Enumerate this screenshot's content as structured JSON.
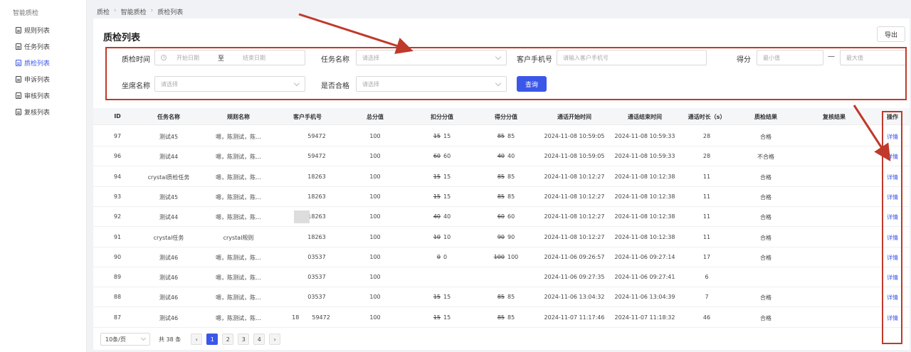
{
  "sidebar": {
    "group_title": "智能质检",
    "items": [
      {
        "label": "规则列表"
      },
      {
        "label": "任务列表"
      },
      {
        "label": "质检列表"
      },
      {
        "label": "申诉列表"
      },
      {
        "label": "审核列表"
      },
      {
        "label": "复核列表"
      }
    ],
    "active_index": 2
  },
  "breadcrumb": [
    "质检",
    "智能质检",
    "质检列表"
  ],
  "page": {
    "title": "质检列表",
    "export_label": "导出"
  },
  "filters": {
    "time_label": "质检时间",
    "start_placeholder": "开始日期",
    "to_label": "至",
    "end_placeholder": "结束日期",
    "task_label": "任务名称",
    "task_placeholder": "请选择",
    "phone_label": "客户手机号",
    "phone_placeholder": "请输入客户手机号",
    "score_label": "得分",
    "min_placeholder": "最小值",
    "dash": "—",
    "max_placeholder": "最大值",
    "agent_label": "坐席名称",
    "agent_placeholder": "请选择",
    "pass_label": "是否合格",
    "pass_placeholder": "请选择",
    "query_label": "查询"
  },
  "table": {
    "headers": [
      "ID",
      "任务名称",
      "规则名称",
      "客户手机号",
      "总分值",
      "扣分分值",
      "得分分值",
      "通话开始时间",
      "通话结束时间",
      "通话时长（s）",
      "质检结果",
      "复核结果",
      "操作"
    ],
    "rows": [
      {
        "id": "97",
        "task": "测试45",
        "rule": "嗯，陈测试，陈...",
        "phone": "59472",
        "total": "100",
        "deduct_old": "15",
        "deduct": "15",
        "score_old": "85",
        "score": "85",
        "start": "2024-11-08 10:59:05",
        "end": "2024-11-08 10:59:33",
        "dur": "28",
        "result": "合格",
        "review": "",
        "op": "详情"
      },
      {
        "id": "96",
        "task": "测试44",
        "rule": "嗯，陈测试，陈...",
        "phone": "59472",
        "total": "100",
        "deduct_old": "60",
        "deduct": "60",
        "score_old": "40",
        "score": "40",
        "start": "2024-11-08 10:59:05",
        "end": "2024-11-08 10:59:33",
        "dur": "28",
        "result": "不合格",
        "review": "",
        "op": "详情"
      },
      {
        "id": "94",
        "task": "crystal质检任务",
        "rule": "嗯，陈测试，陈...",
        "phone": "18263",
        "total": "100",
        "deduct_old": "15",
        "deduct": "15",
        "score_old": "85",
        "score": "85",
        "start": "2024-11-08 10:12:27",
        "end": "2024-11-08 10:12:38",
        "dur": "11",
        "result": "合格",
        "review": "",
        "op": "详情"
      },
      {
        "id": "93",
        "task": "测试45",
        "rule": "嗯，陈测试，陈...",
        "phone": "18263",
        "total": "100",
        "deduct_old": "15",
        "deduct": "15",
        "score_old": "85",
        "score": "85",
        "start": "2024-11-08 10:12:27",
        "end": "2024-11-08 10:12:38",
        "dur": "11",
        "result": "合格",
        "review": "",
        "op": "详情"
      },
      {
        "id": "92",
        "task": "测试44",
        "rule": "嗯，陈测试，陈...",
        "phone": "18263",
        "total": "100",
        "deduct_old": "40",
        "deduct": "40",
        "score_old": "60",
        "score": "60",
        "start": "2024-11-08 10:12:27",
        "end": "2024-11-08 10:12:38",
        "dur": "11",
        "result": "合格",
        "review": "",
        "op": "详情"
      },
      {
        "id": "91",
        "task": "crystal任务",
        "rule": "crystal规则",
        "phone": "18263",
        "total": "100",
        "deduct_old": "10",
        "deduct": "10",
        "score_old": "90",
        "score": "90",
        "start": "2024-11-08 10:12:27",
        "end": "2024-11-08 10:12:38",
        "dur": "11",
        "result": "合格",
        "review": "",
        "op": "详情"
      },
      {
        "id": "90",
        "task": "测试46",
        "rule": "嗯，陈测试，陈...",
        "phone": "03537",
        "total": "100",
        "deduct_old": "0",
        "deduct": "0",
        "score_old": "100",
        "score": "100",
        "start": "2024-11-06 09:26:57",
        "end": "2024-11-06 09:27:14",
        "dur": "17",
        "result": "合格",
        "review": "",
        "op": "详情"
      },
      {
        "id": "89",
        "task": "测试46",
        "rule": "嗯，陈测试，陈...",
        "phone": "03537",
        "total": "100",
        "deduct_old": "",
        "deduct": "",
        "score_old": "",
        "score": "",
        "start": "2024-11-06 09:27:35",
        "end": "2024-11-06 09:27:41",
        "dur": "6",
        "result": "",
        "review": "",
        "op": "详情"
      },
      {
        "id": "88",
        "task": "测试46",
        "rule": "嗯，陈测试，陈...",
        "phone": "03537",
        "total": "100",
        "deduct_old": "15",
        "deduct": "15",
        "score_old": "85",
        "score": "85",
        "start": "2024-11-06 13:04:32",
        "end": "2024-11-06 13:04:39",
        "dur": "7",
        "result": "合格",
        "review": "",
        "op": "详情"
      },
      {
        "id": "87",
        "task": "测试46",
        "rule": "嗯，陈测试，陈...",
        "phone_prefix": "18",
        "phone": "59472",
        "total": "100",
        "deduct_old": "15",
        "deduct": "15",
        "score_old": "85",
        "score": "85",
        "start": "2024-11-07 11:17:46",
        "end": "2024-11-07 11:18:32",
        "dur": "46",
        "result": "合格",
        "review": "",
        "op": "详情"
      }
    ]
  },
  "pagination": {
    "page_size": "10条/页",
    "total": "共 38 条",
    "prev": "‹",
    "pages": [
      "1",
      "2",
      "3",
      "4"
    ],
    "next": "›",
    "current": "1"
  },
  "colors": {
    "accent": "#3a57e8",
    "annotation": "#c0392b"
  }
}
